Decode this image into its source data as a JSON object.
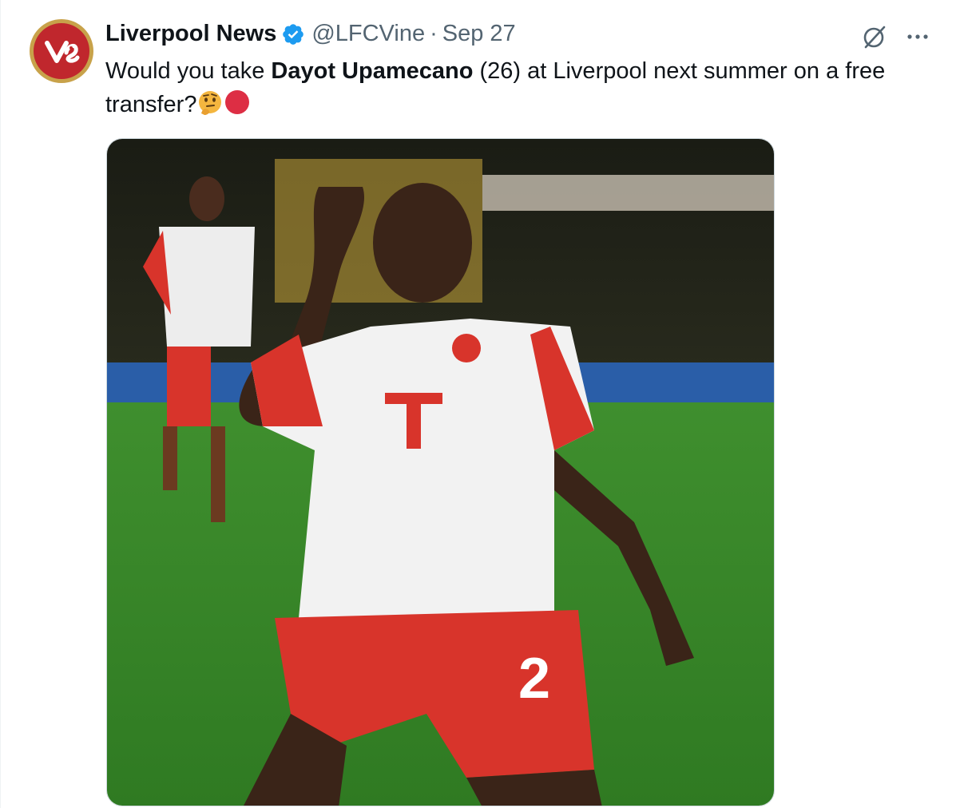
{
  "tweet": {
    "author_name": "Liverpool News",
    "handle": "@LFCVine",
    "separator": "·",
    "date": "Sep 27",
    "text_before": "Would you take ",
    "text_bold": "Dayot Upamecano",
    "text_after": " (26) at Liverpool next summer on a free transfer?",
    "verified": true
  },
  "icons": {
    "avatar": "vine-logo-avatar",
    "verified": "verified-badge-icon",
    "grok": "grok-icon",
    "more": "more-icon",
    "emoji_1": "thinking-face-emoji",
    "emoji_2": "red-circle-emoji"
  },
  "media": {
    "description_icon": "photo",
    "jersey_number": "2"
  },
  "colors": {
    "verified_blue": "#1d9bf0",
    "text_primary": "#0f1419",
    "text_secondary": "#536471",
    "avatar_red": "#c0272d",
    "avatar_gold": "#c8a24a"
  }
}
